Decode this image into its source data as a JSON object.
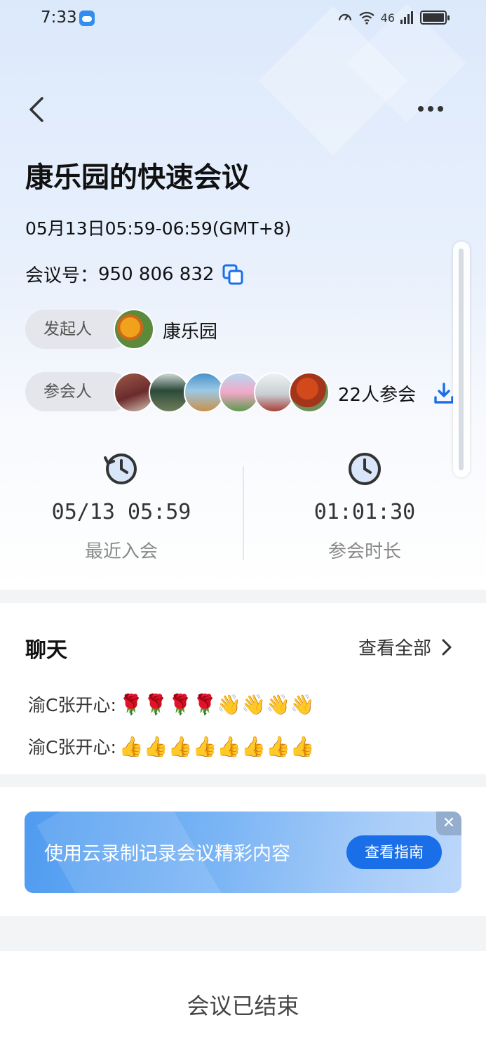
{
  "status_bar": {
    "time": "7:33",
    "network": "46",
    "icons": [
      "weather-icon",
      "speed-icon",
      "wifi-icon",
      "signal-icon",
      "battery-icon"
    ]
  },
  "header": {
    "title": "康乐园的快速会议",
    "datetime": "05月13日05:59-06:59(GMT+8)",
    "meeting_id_label": "会议号：",
    "meeting_id": "950 806 832"
  },
  "host": {
    "label": "发起人",
    "name": "康乐园"
  },
  "participants": {
    "label": "参会人",
    "count_text": "22人参会",
    "avatar_count": 6
  },
  "stats": [
    {
      "value": "05/13 05:59",
      "label": "最近入会"
    },
    {
      "value": "01:01:30",
      "label": "参会时长"
    }
  ],
  "chat": {
    "title": "聊天",
    "view_all": "查看全部",
    "messages": [
      {
        "sender": "渝C张开心:",
        "content": "🌹🌹🌹🌹👋👋👋👋"
      },
      {
        "sender": "渝C张开心:",
        "content": "👍👍👍👍👍👍👍👍"
      }
    ]
  },
  "banner": {
    "text": "使用云录制记录会议精彩内容",
    "button": "查看指南",
    "close": "✕"
  },
  "footer": {
    "status": "会议已结束"
  },
  "colors": {
    "accent": "#1a6fe8",
    "banner_start": "#4f9bf0",
    "header_bg": "#dce9fb"
  }
}
